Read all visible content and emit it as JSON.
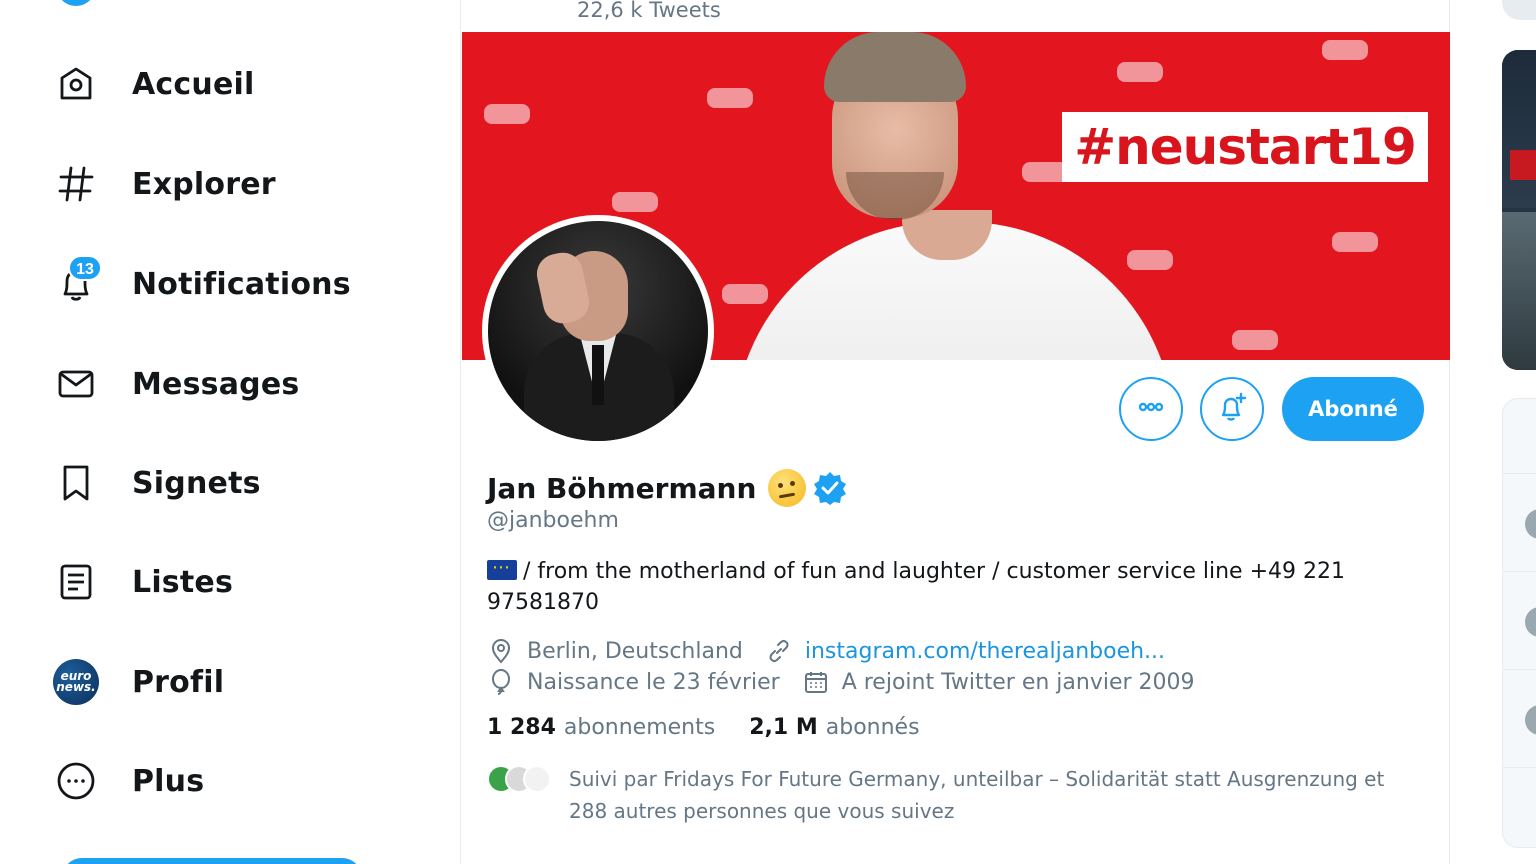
{
  "nav": {
    "items": [
      {
        "label": "Accueil",
        "icon": "home-icon"
      },
      {
        "label": "Explorer",
        "icon": "hashtag-icon"
      },
      {
        "label": "Notifications",
        "icon": "bell-icon",
        "badge": "13"
      },
      {
        "label": "Messages",
        "icon": "envelope-icon"
      },
      {
        "label": "Signets",
        "icon": "bookmark-icon"
      },
      {
        "label": "Listes",
        "icon": "list-icon"
      },
      {
        "label": "Profil",
        "icon": "profile-avatar",
        "avatar_text": "euro news."
      },
      {
        "label": "Plus",
        "icon": "more-circle-icon"
      }
    ]
  },
  "header": {
    "tweets_count": "22,6 k Tweets"
  },
  "banner": {
    "hashtag": "#neustart19"
  },
  "profile": {
    "name": "Jan Böhmermann",
    "handle": "@janboehm",
    "bio": "/ from the motherland of fun and laughter / customer service line +49 221 97581870",
    "location": "Berlin, Deutschland",
    "website": "instagram.com/therealjanboeh...",
    "birthday": "Naissance le 23 février",
    "joined": "A rejoint Twitter en janvier 2009",
    "following_count": "1 284",
    "following_label": "abonnements",
    "followers_count": "2,1 M",
    "followers_label": "abonnés",
    "followed_by": "Suivi par Fridays For Future Germany, unteilbar – Solidarität statt Ausgrenzung et 288 autres personnes que vous suivez"
  },
  "actions": {
    "more_icon": "more-icon",
    "notify_icon": "bell-plus-icon",
    "follow_label": "Abonné"
  },
  "colors": {
    "accent": "#1da1f2",
    "link": "#1b95e0",
    "banner_red": "#e3161f",
    "secondary_text": "#657786"
  }
}
